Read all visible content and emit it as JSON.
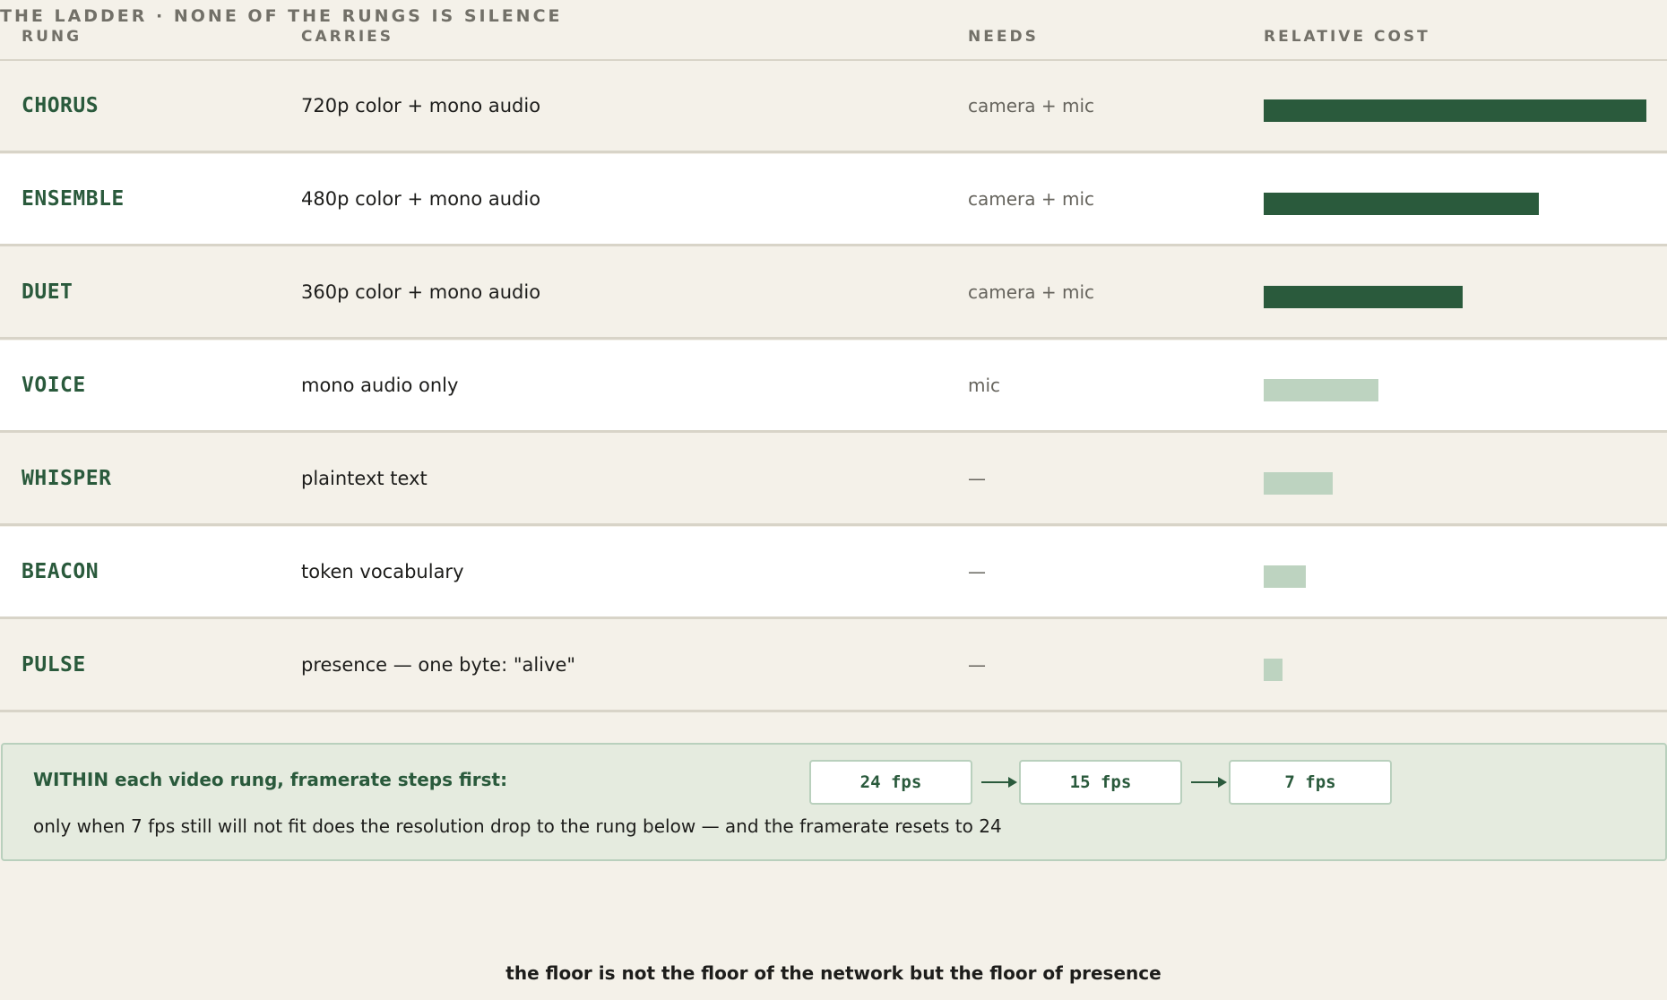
{
  "eyebrow": "THE LADDER · NONE OF THE RUNGS IS SILENCE",
  "columns": {
    "rung": "RUNG",
    "carries": "CARRIES",
    "needs": "NEEDS",
    "cost": "RELATIVE COST"
  },
  "colors": {
    "bar_video": "#2a5a3c",
    "bar_fallback": "#bdd3c0",
    "accent": "#2a5a3c"
  },
  "rungs": [
    {
      "name": "CHORUS",
      "carries": "720p color + mono audio",
      "needs": "camera + mic",
      "relative_cost": 1.0,
      "kind": "video"
    },
    {
      "name": "ENSEMBLE",
      "carries": "480p color + mono audio",
      "needs": "camera + mic",
      "relative_cost": 0.72,
      "kind": "video"
    },
    {
      "name": "DUET",
      "carries": "360p color + mono audio",
      "needs": "camera + mic",
      "relative_cost": 0.52,
      "kind": "video"
    },
    {
      "name": "VOICE",
      "carries": "mono audio only",
      "needs": "mic",
      "relative_cost": 0.3,
      "kind": "fallback"
    },
    {
      "name": "WHISPER",
      "carries": "plaintext text",
      "needs": "—",
      "relative_cost": 0.18,
      "kind": "fallback"
    },
    {
      "name": "BEACON",
      "carries": "token vocabulary",
      "needs": "—",
      "relative_cost": 0.11,
      "kind": "fallback"
    },
    {
      "name": "PULSE",
      "carries": "presence — one byte: \"alive\"",
      "needs": "—",
      "relative_cost": 0.05,
      "kind": "fallback"
    }
  ],
  "note": {
    "title": "WITHIN each video rung, framerate steps first:",
    "body": "only when 7 fps still will not fit does the resolution drop to the rung below — and the framerate resets to 24",
    "steps": [
      "24 fps",
      "15 fps",
      "7 fps"
    ]
  },
  "footer": "the floor is not the floor of the network but the floor of presence"
}
